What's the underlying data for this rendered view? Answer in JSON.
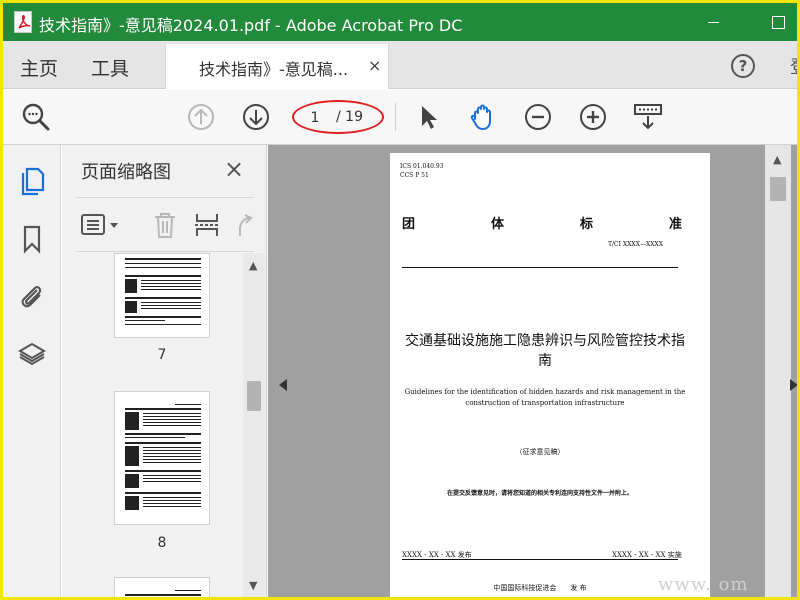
{
  "window": {
    "title": "技术指南》-意见稿2024.01.pdf - Adobe Acrobat Pro DC",
    "app_icon": "acrobat-pdf-icon",
    "accent": "#218a3b"
  },
  "menu": {
    "home": "主页",
    "tools": "工具"
  },
  "doc_tab": {
    "label": "技术指南》-意见稿...",
    "close_glyph": "×"
  },
  "help_glyph": "?",
  "tab_overflow": "登",
  "toolbar": {
    "current_page": "1",
    "total_pages": "/ 19",
    "icons": [
      "search-icon",
      "prev-page-icon",
      "next-page-icon",
      "select-arrow-icon",
      "hand-icon",
      "zoom-out-icon",
      "zoom-in-icon",
      "keyboard-scroll-icon"
    ]
  },
  "nav_rail": [
    "page-thumbnails-icon",
    "bookmark-icon",
    "attachment-icon",
    "layers-icon"
  ],
  "thumb_panel": {
    "title": "页面缩略图",
    "close_glyph": "×",
    "thumbs": [
      {
        "page": "7"
      },
      {
        "page": "8"
      }
    ]
  },
  "document_page": {
    "ics": "ICS  01.040.93",
    "ccs": "CCS  P 51",
    "standard_chars": [
      "团",
      "体",
      "标",
      "准"
    ],
    "code": "T/CI  XXXX—XXXX",
    "title_cn": "交通基础设施施工隐患辨识与风险管控技术指南",
    "title_en": "Guidelines for the identification of hidden hazards and risk management in the construction of transportation infrastructure",
    "draft": "（征求意见稿）",
    "note": "在提交反馈意见时，请将您知道的相关专利连同支持性文件一并附上。",
    "issue_date": "XXXX - XX - XX 发布",
    "impl_date": "XXXX - XX - XX 实施",
    "publisher": "中国国际科技促进会　　发 布"
  },
  "watermark": "www.        om"
}
